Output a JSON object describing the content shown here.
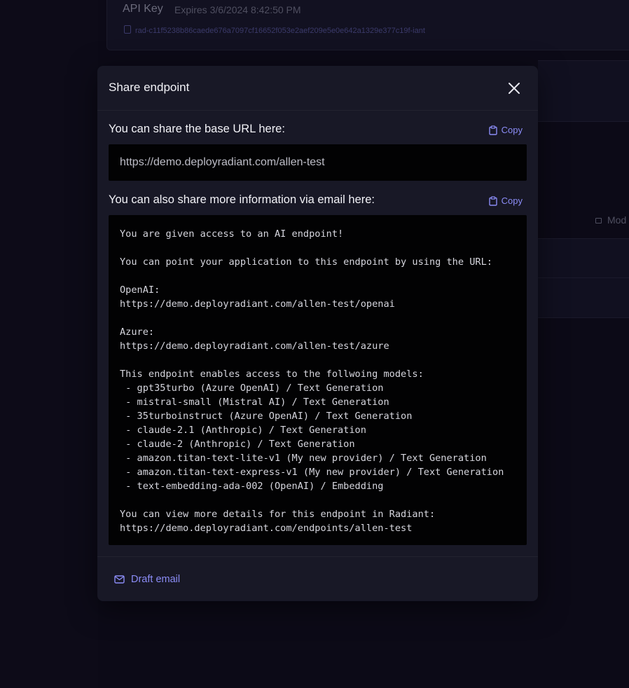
{
  "background": {
    "api_key_title": "API Key",
    "api_key_expiry": "Expires 3/6/2024 8:42:50 PM",
    "api_key_value": "rad-c11f5238b86caede676a7097cf16652f053e2aef209e5e0e642a1329e377c19f-iant",
    "mod_label": "Mod"
  },
  "modal": {
    "title": "Share endpoint",
    "close_icon": "close-icon",
    "base_url_label": "You can share the base URL here:",
    "copy_label": "Copy",
    "base_url": "https://demo.deployradiant.com/allen-test",
    "email_label": "You can also share more information via email here:",
    "email_body": "You are given access to an AI endpoint!\n\nYou can point your application to this endpoint by using the URL:\n\nOpenAI:\nhttps://demo.deployradiant.com/allen-test/openai\n\nAzure:\nhttps://demo.deployradiant.com/allen-test/azure\n\nThis endpoint enables access to the follwoing models:\n - gpt35turbo (Azure OpenAI) / Text Generation\n - mistral-small (Mistral AI) / Text Generation\n - 35turboinstruct (Azure OpenAI) / Text Generation\n - claude-2.1 (Anthropic) / Text Generation\n - claude-2 (Anthropic) / Text Generation\n - amazon.titan-text-lite-v1 (My new provider) / Text Generation\n - amazon.titan-text-express-v1 (My new provider) / Text Generation\n - text-embedding-ada-002 (OpenAI) / Embedding\n\nYou can view more details for this endpoint in Radiant:\nhttps://demo.deployradiant.com/endpoints/allen-test",
    "draft_email_label": "Draft email"
  },
  "colors": {
    "accent": "#8b8cf6",
    "modal_bg": "#181826",
    "page_bg": "#0c0a17",
    "code_bg": "#020203"
  }
}
